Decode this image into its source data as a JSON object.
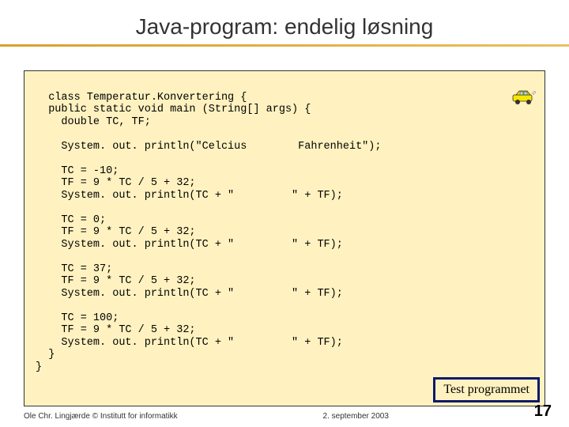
{
  "title": "Java-program: endelig løsning",
  "code": "class Temperatur.Konvertering {\n  public static void main (String[] args) {\n    double TC, TF;\n\n    System. out. println(\"Celcius        Fahrenheit\");\n\n    TC = -10;\n    TF = 9 * TC / 5 + 32;\n    System. out. println(TC + \"         \" + TF);\n\n    TC = 0;\n    TF = 9 * TC / 5 + 32;\n    System. out. println(TC + \"         \" + TF);\n\n    TC = 37;\n    TF = 9 * TC / 5 + 32;\n    System. out. println(TC + \"         \" + TF);\n\n    TC = 100;\n    TF = 9 * TC / 5 + 32;\n    System. out. println(TC + \"         \" + TF);\n  }\n}",
  "button": {
    "test_label": "Test programmet"
  },
  "footer": {
    "left": "Ole Chr. Lingjærde © Institutt for informatikk",
    "center": "2. september 2003",
    "page": "17"
  },
  "icons": {
    "car": "car-icon"
  }
}
